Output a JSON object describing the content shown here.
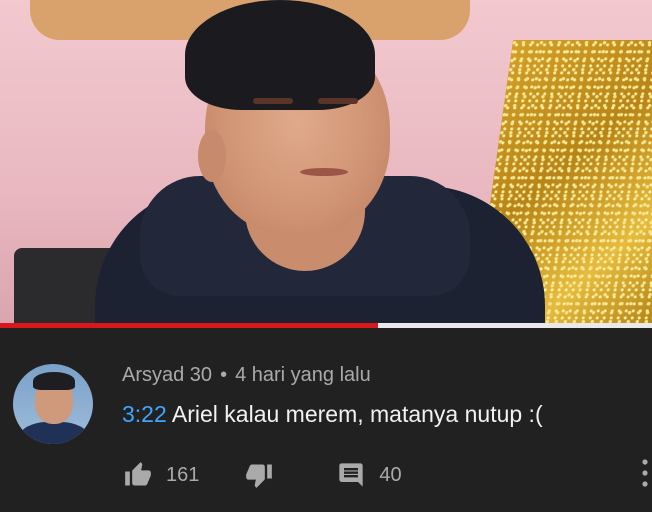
{
  "video": {
    "progress_fraction": 0.58,
    "progress_color": "#d7191b"
  },
  "comment": {
    "author": "Arsyad 30",
    "separator": "•",
    "time_ago": "4 hari yang lalu",
    "timestamp_link": "3:22",
    "body": "Ariel kalau merem, matanya nutup :(",
    "likes": "161",
    "replies": "40",
    "link_color": "#3ea6ff"
  },
  "icons": {
    "like": "thumb-up-icon",
    "dislike": "thumb-down-icon",
    "reply": "comment-icon",
    "more": "more-vert-icon"
  }
}
